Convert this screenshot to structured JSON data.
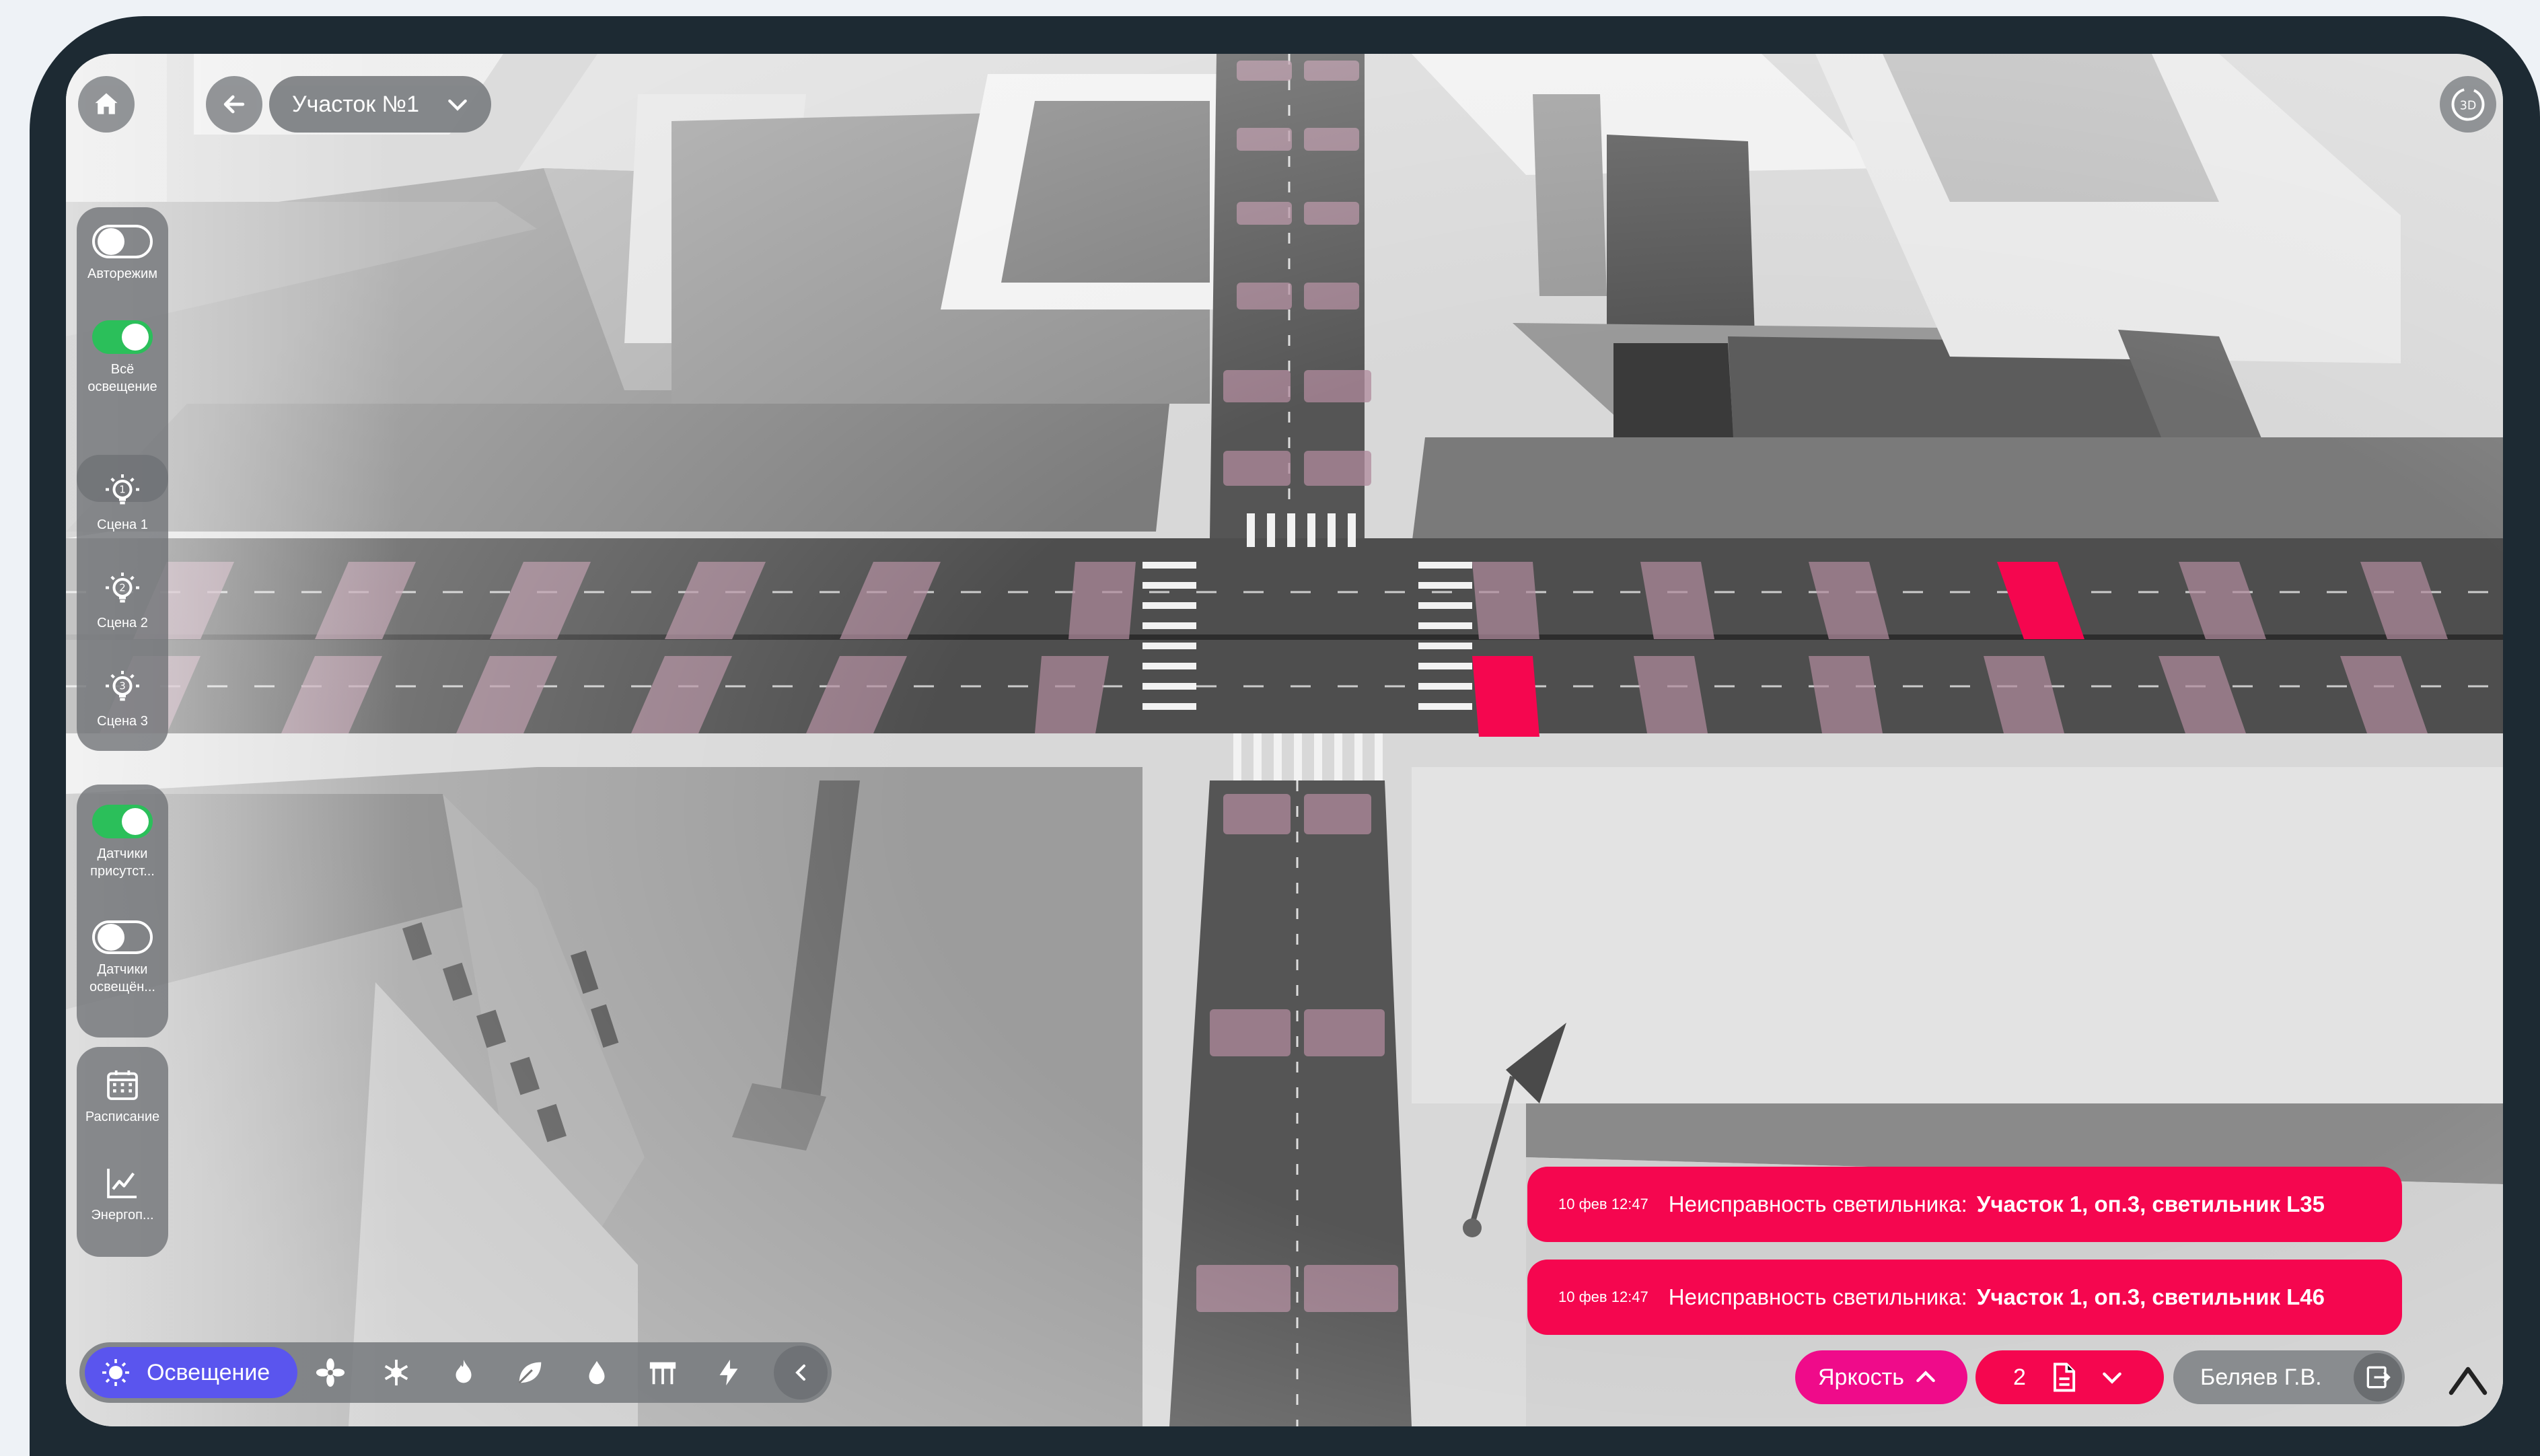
{
  "header": {
    "home_icon": "home-icon",
    "back_icon": "arrow-left-icon",
    "section_label": "Участок №1",
    "view_mode_label": "3D"
  },
  "left_panel": {
    "auto_mode": {
      "label": "Авторежим",
      "on": false
    },
    "all_lighting": {
      "label": "Всё освещение",
      "on": true
    },
    "scenes": [
      {
        "label": "Сцена 1",
        "num": "1"
      },
      {
        "label": "Сцена 2",
        "num": "2"
      },
      {
        "label": "Сцена 3",
        "num": "3"
      }
    ],
    "presence_sensors": {
      "label": "Датчики присутст...",
      "on": true
    },
    "light_sensors": {
      "label": "Датчики освещён...",
      "on": false
    },
    "schedule_label": "Расписание",
    "energy_label": "Энергоп..."
  },
  "alerts": [
    {
      "time": "10 фев 12:47",
      "message": "Неисправность светильника:",
      "detail": "Участок 1, оп.3, светильник L35"
    },
    {
      "time": "10 фев 12:47",
      "message": "Неисправность светильника:",
      "detail": "Участок 1, оп.3, светильник L46"
    }
  ],
  "bottom_bar": {
    "active_label": "Освещение",
    "tools": [
      "fan-icon",
      "snowflake-icon",
      "flame-icon",
      "leaf-icon",
      "droplet-icon",
      "gate-icon",
      "bolt-icon",
      "chevron-left-icon"
    ]
  },
  "brightness_label": "Яркость",
  "docs_count": "2",
  "user_name": "Беляев Г.В.",
  "colors": {
    "accent": "#5a55ee",
    "alert": "#f5064f",
    "toggle_on": "#2bbf5a"
  }
}
